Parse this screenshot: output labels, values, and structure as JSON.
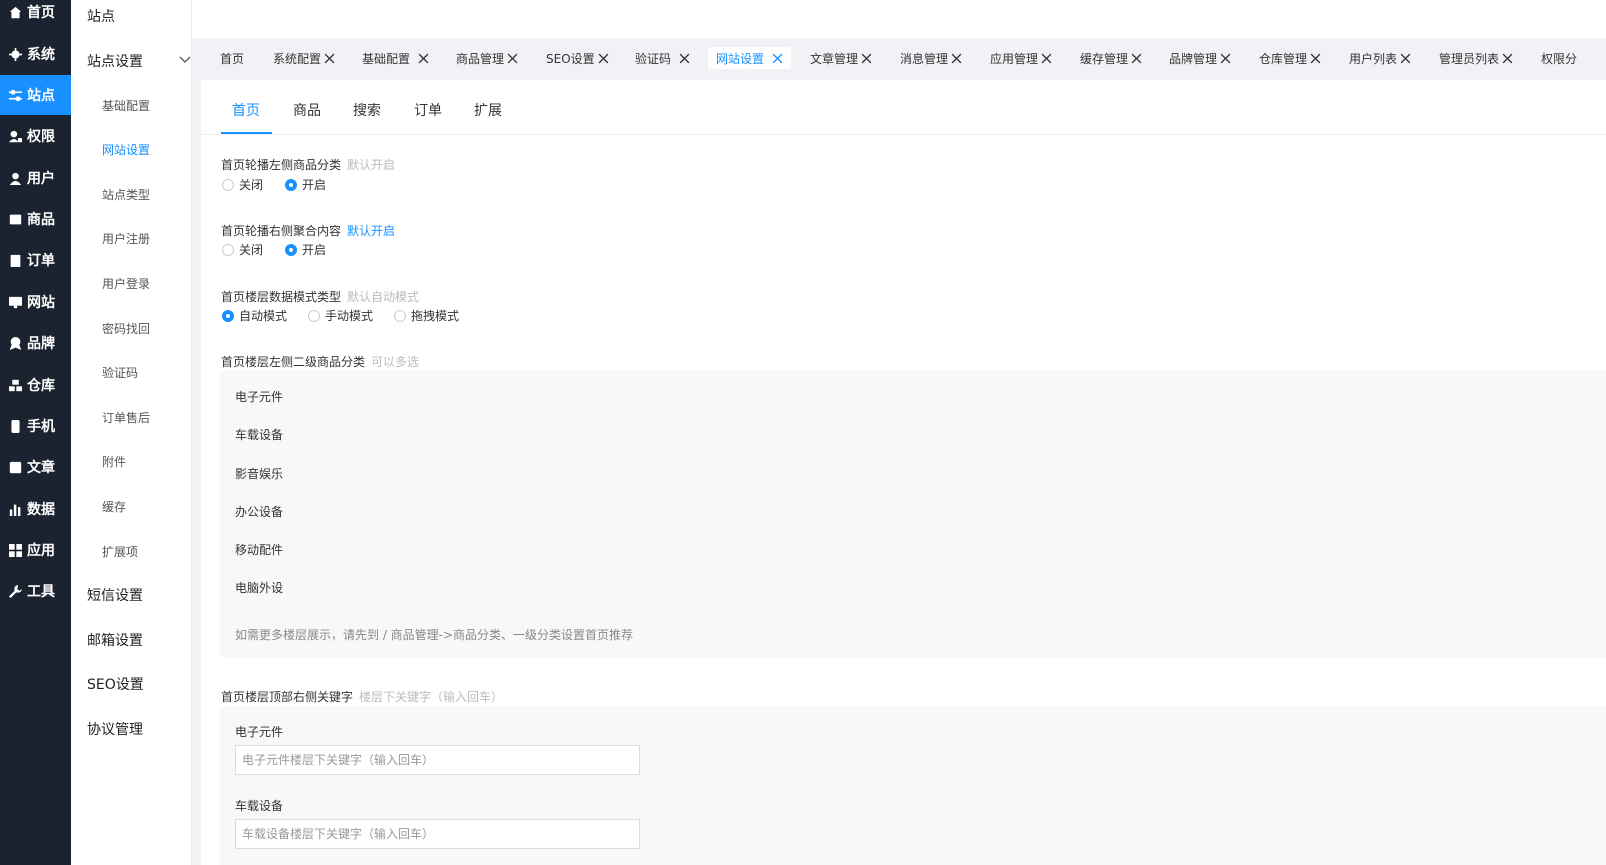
{
  "mainnav": [
    {
      "label": "首页",
      "icon": "home-icon"
    },
    {
      "label": "系统",
      "icon": "gear-icon"
    },
    {
      "label": "站点",
      "icon": "sliders-icon"
    },
    {
      "label": "权限",
      "icon": "user-lock-icon"
    },
    {
      "label": "用户",
      "icon": "user-icon"
    },
    {
      "label": "商品",
      "icon": "box-icon"
    },
    {
      "label": "订单",
      "icon": "clipboard-icon"
    },
    {
      "label": "网站",
      "icon": "monitor-icon"
    },
    {
      "label": "品牌",
      "icon": "badge-icon"
    },
    {
      "label": "仓库",
      "icon": "warehouse-icon"
    },
    {
      "label": "手机",
      "icon": "phone-icon"
    },
    {
      "label": "文章",
      "icon": "article-icon"
    },
    {
      "label": "数据",
      "icon": "bar-chart-icon"
    },
    {
      "label": "应用",
      "icon": "apps-icon"
    },
    {
      "label": "工具",
      "icon": "wrench-icon"
    }
  ],
  "subnav": {
    "title": "站点",
    "group_open": "站点设置",
    "items": [
      "基础配置",
      "网站设置",
      "站点类型",
      "用户注册",
      "用户登录",
      "密码找回",
      "验证码",
      "订单售后",
      "附件",
      "缓存",
      "扩展项"
    ],
    "groups": [
      "短信设置",
      "邮箱设置",
      "SEO设置",
      "协议管理"
    ]
  },
  "tabs": [
    "首页",
    "系统配置",
    "基础配置",
    "商品管理",
    "SEO设置",
    "验证码",
    "网站设置",
    "文章管理",
    "消息管理",
    "应用管理",
    "缓存管理",
    "品牌管理",
    "仓库管理",
    "用户列表",
    "管理员列表",
    "权限分"
  ],
  "subtabs": [
    "首页",
    "商品",
    "搜索",
    "订单",
    "扩展"
  ],
  "form": {
    "f1": {
      "label": "首页轮播左侧商品分类",
      "hint": "默认开启",
      "off": "关闭",
      "on": "开启"
    },
    "f2": {
      "label": "首页轮播右侧聚合内容",
      "hint": "默认开启",
      "off": "关闭",
      "on": "开启"
    },
    "f3": {
      "label": "首页楼层数据模式类型",
      "hint": "默认自动模式",
      "opts": [
        "自动模式",
        "手动模式",
        "拖拽模式"
      ]
    },
    "f4": {
      "label": "首页楼层左侧二级商品分类",
      "hint": "可以多选",
      "cats": [
        "电子元件",
        "车载设备",
        "影音娱乐",
        "办公设备",
        "移动配件",
        "电脑外设"
      ],
      "note": "如需更多楼层展示，请先到 / 商品管理->商品分类、一级分类设置首页推荐"
    },
    "f5": {
      "label": "首页楼层顶部右侧关键字",
      "hint": "楼层下关键字（输入回车）",
      "kw": [
        {
          "label": "电子元件",
          "placeholder": "电子元件楼层下关键字（输入回车）"
        },
        {
          "label": "车载设备",
          "placeholder": "车载设备楼层下关键字（输入回车）"
        }
      ]
    }
  },
  "colors": {
    "accent": "#1890ff",
    "nav_bg": "#1b2330"
  }
}
